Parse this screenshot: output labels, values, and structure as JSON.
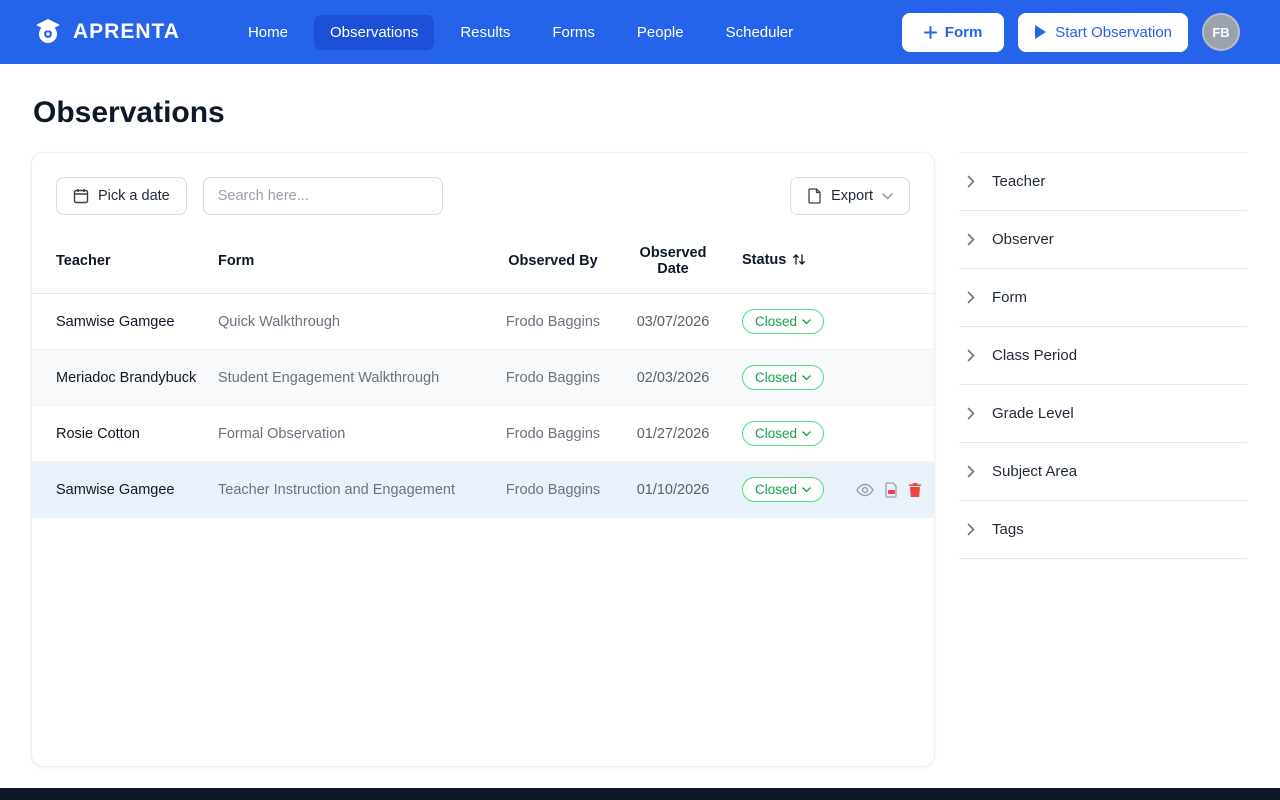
{
  "navbar": {
    "brand": "APRENTA",
    "items": [
      {
        "label": "Home"
      },
      {
        "label": "Observations"
      },
      {
        "label": "Results"
      },
      {
        "label": "Forms"
      },
      {
        "label": "People"
      },
      {
        "label": "Scheduler"
      }
    ],
    "form_button_label": "Form",
    "start_button_label": "Start Observation",
    "avatar_initials": "FB"
  },
  "page": {
    "title": "Observations"
  },
  "toolbar": {
    "pick_date_label": "Pick a date",
    "search_placeholder": "Search here...",
    "export_label": "Export"
  },
  "table": {
    "headers": [
      "Teacher",
      "Form",
      "Observed By",
      "Observed Date",
      "Status"
    ],
    "rows": [
      {
        "teacher": "Samwise Gamgee",
        "form": "Quick Walkthrough",
        "observed_by": "Frodo Baggins",
        "observed_date": "03/07/2026",
        "status": "Closed"
      },
      {
        "teacher": "Meriadoc Brandybuck",
        "form": "Student Engagement Walkthrough",
        "observed_by": "Frodo Baggins",
        "observed_date": "02/03/2026",
        "status": "Closed"
      },
      {
        "teacher": "Rosie Cotton",
        "form": "Formal Observation",
        "observed_by": "Frodo Baggins",
        "observed_date": "01/27/2026",
        "status": "Closed"
      },
      {
        "teacher": "Samwise Gamgee",
        "form": "Teacher Instruction and Engagement",
        "observed_by": "Frodo Baggins",
        "observed_date": "01/10/2026",
        "status": "Closed"
      }
    ]
  },
  "filters": {
    "items": [
      "Teacher",
      "Observer",
      "Form",
      "Class Period",
      "Grade Level",
      "Subject Area",
      "Tags"
    ]
  },
  "colors": {
    "brand_blue": "#2563eb",
    "active_nav_blue": "#1d4fd8",
    "status_green": "#16a34a",
    "danger_red": "#ef4444"
  }
}
